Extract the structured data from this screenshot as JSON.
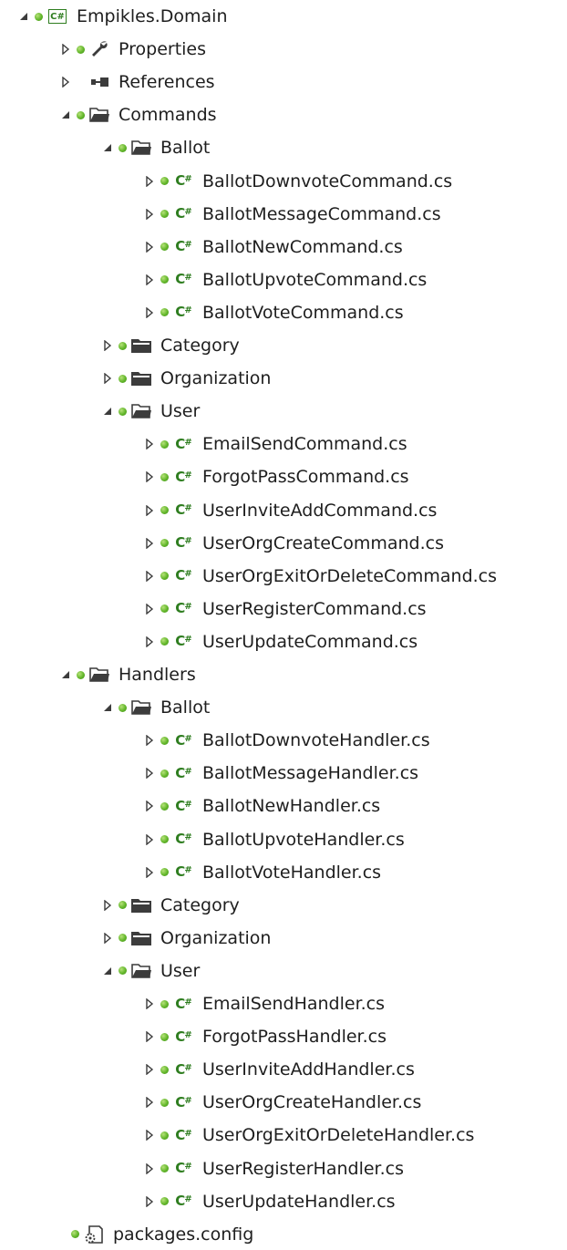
{
  "tree": [
    {
      "label": "Empikles.Domain",
      "depth": 0,
      "expander": "expanded",
      "icon": "csharp-project-icon",
      "status": true
    },
    {
      "label": "Properties",
      "depth": 1,
      "expander": "collapsed",
      "icon": "wrench-icon",
      "status": true
    },
    {
      "label": "References",
      "depth": 1,
      "expander": "collapsed",
      "icon": "references-icon",
      "status": false
    },
    {
      "label": "Commands",
      "depth": 1,
      "expander": "expanded",
      "icon": "folder-open-icon",
      "status": true
    },
    {
      "label": "Ballot",
      "depth": 2,
      "expander": "expanded",
      "icon": "folder-open-icon",
      "status": true
    },
    {
      "label": "BallotDownvoteCommand.cs",
      "depth": 3,
      "expander": "collapsed",
      "icon": "csharp-file-icon",
      "status": true
    },
    {
      "label": "BallotMessageCommand.cs",
      "depth": 3,
      "expander": "collapsed",
      "icon": "csharp-file-icon",
      "status": true
    },
    {
      "label": "BallotNewCommand.cs",
      "depth": 3,
      "expander": "collapsed",
      "icon": "csharp-file-icon",
      "status": true
    },
    {
      "label": "BallotUpvoteCommand.cs",
      "depth": 3,
      "expander": "collapsed",
      "icon": "csharp-file-icon",
      "status": true
    },
    {
      "label": "BallotVoteCommand.cs",
      "depth": 3,
      "expander": "collapsed",
      "icon": "csharp-file-icon",
      "status": true
    },
    {
      "label": "Category",
      "depth": 2,
      "expander": "collapsed",
      "icon": "folder-closed-icon",
      "status": true
    },
    {
      "label": "Organization",
      "depth": 2,
      "expander": "collapsed",
      "icon": "folder-closed-icon",
      "status": true
    },
    {
      "label": "User",
      "depth": 2,
      "expander": "expanded",
      "icon": "folder-open-icon",
      "status": true
    },
    {
      "label": "EmailSendCommand.cs",
      "depth": 3,
      "expander": "collapsed",
      "icon": "csharp-file-icon",
      "status": true
    },
    {
      "label": "ForgotPassCommand.cs",
      "depth": 3,
      "expander": "collapsed",
      "icon": "csharp-file-icon",
      "status": true
    },
    {
      "label": "UserInviteAddCommand.cs",
      "depth": 3,
      "expander": "collapsed",
      "icon": "csharp-file-icon",
      "status": true
    },
    {
      "label": "UserOrgCreateCommand.cs",
      "depth": 3,
      "expander": "collapsed",
      "icon": "csharp-file-icon",
      "status": true
    },
    {
      "label": "UserOrgExitOrDeleteCommand.cs",
      "depth": 3,
      "expander": "collapsed",
      "icon": "csharp-file-icon",
      "status": true
    },
    {
      "label": "UserRegisterCommand.cs",
      "depth": 3,
      "expander": "collapsed",
      "icon": "csharp-file-icon",
      "status": true
    },
    {
      "label": "UserUpdateCommand.cs",
      "depth": 3,
      "expander": "collapsed",
      "icon": "csharp-file-icon",
      "status": true
    },
    {
      "label": "Handlers",
      "depth": 1,
      "expander": "expanded",
      "icon": "folder-open-icon",
      "status": true
    },
    {
      "label": "Ballot",
      "depth": 2,
      "expander": "expanded",
      "icon": "folder-open-icon",
      "status": true
    },
    {
      "label": "BallotDownvoteHandler.cs",
      "depth": 3,
      "expander": "collapsed",
      "icon": "csharp-file-icon",
      "status": true
    },
    {
      "label": "BallotMessageHandler.cs",
      "depth": 3,
      "expander": "collapsed",
      "icon": "csharp-file-icon",
      "status": true
    },
    {
      "label": "BallotNewHandler.cs",
      "depth": 3,
      "expander": "collapsed",
      "icon": "csharp-file-icon",
      "status": true
    },
    {
      "label": "BallotUpvoteHandler.cs",
      "depth": 3,
      "expander": "collapsed",
      "icon": "csharp-file-icon",
      "status": true
    },
    {
      "label": "BallotVoteHandler.cs",
      "depth": 3,
      "expander": "collapsed",
      "icon": "csharp-file-icon",
      "status": true
    },
    {
      "label": "Category",
      "depth": 2,
      "expander": "collapsed",
      "icon": "folder-closed-icon",
      "status": true
    },
    {
      "label": "Organization",
      "depth": 2,
      "expander": "collapsed",
      "icon": "folder-closed-icon",
      "status": true
    },
    {
      "label": "User",
      "depth": 2,
      "expander": "expanded",
      "icon": "folder-open-icon",
      "status": true
    },
    {
      "label": "EmailSendHandler.cs",
      "depth": 3,
      "expander": "collapsed",
      "icon": "csharp-file-icon",
      "status": true
    },
    {
      "label": "ForgotPassHandler.cs",
      "depth": 3,
      "expander": "collapsed",
      "icon": "csharp-file-icon",
      "status": true
    },
    {
      "label": "UserInviteAddHandler.cs",
      "depth": 3,
      "expander": "collapsed",
      "icon": "csharp-file-icon",
      "status": true
    },
    {
      "label": "UserOrgCreateHandler.cs",
      "depth": 3,
      "expander": "collapsed",
      "icon": "csharp-file-icon",
      "status": true
    },
    {
      "label": "UserOrgExitOrDeleteHandler.cs",
      "depth": 3,
      "expander": "collapsed",
      "icon": "csharp-file-icon",
      "status": true
    },
    {
      "label": "UserRegisterHandler.cs",
      "depth": 3,
      "expander": "collapsed",
      "icon": "csharp-file-icon",
      "status": true
    },
    {
      "label": "UserUpdateHandler.cs",
      "depth": 3,
      "expander": "collapsed",
      "icon": "csharp-file-icon",
      "status": true
    },
    {
      "label": "packages.config",
      "depth": 1,
      "expander": "none",
      "icon": "config-file-icon",
      "status": true
    }
  ],
  "colors": {
    "text": "#1e1e1e",
    "status_green": "#62b62a",
    "csharp_green": "#2e7d1f",
    "folder_dark": "#3c3c3c"
  }
}
